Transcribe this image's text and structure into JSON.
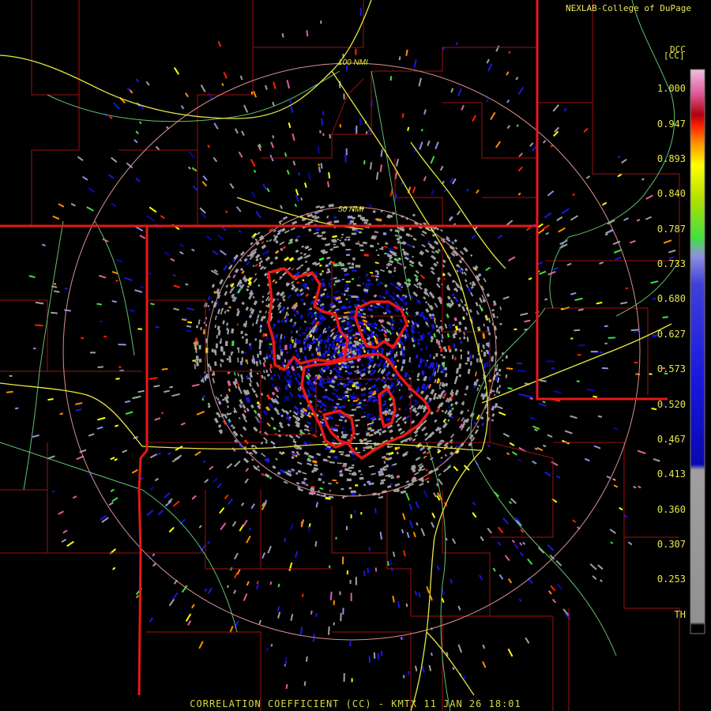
{
  "credit": "NEXLAB-College of DuPage",
  "footer": "CORRELATION COEFFICIENT (CC) - KMTX 11 JAN 26 18:01",
  "range_rings": [
    "100 NMI",
    "50 NMI"
  ],
  "legend": {
    "product": "DCC",
    "unit": "[CC]",
    "ticks": [
      "1.000",
      "0.947",
      "0.893",
      "0.840",
      "0.787",
      "0.733",
      "0.680",
      "0.627",
      "0.573",
      "0.520",
      "0.467",
      "0.413",
      "0.360",
      "0.307",
      "0.253",
      "TH"
    ],
    "colors": {
      "top": "#f0c0e0",
      "pink": "#e060a0",
      "dark_red": "#b00010",
      "red": "#ff2000",
      "orange": "#ff9000",
      "yellow": "#ffff00",
      "yellow_green": "#b0e000",
      "green": "#40e040",
      "lavender": "#9090e0",
      "blue": "#1818e0",
      "dark_blue": "#0808b0",
      "gray": "#a0a0a0",
      "bottom": "#000000"
    }
  },
  "colors": {
    "state_border": "#e81818",
    "county_border": "#a01010",
    "highway": "#e8e840",
    "river": "#60c070",
    "range_ring": "#d89090",
    "warning_polygon": "#e81818"
  }
}
